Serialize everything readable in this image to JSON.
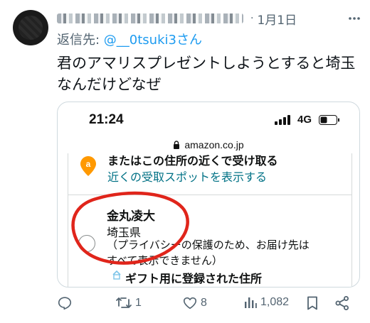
{
  "tweet": {
    "date": "1月1日",
    "reply_to_prefix": "返信先: ",
    "reply_to_mention": "@__0tsuki3さん",
    "text_line1": "君のアマリスプレゼントしようとすると埼玉",
    "text_line2": "なんだけどなぜ"
  },
  "screenshot": {
    "time": "21:24",
    "network": "4G",
    "url": "amazon.co.jp",
    "pickup_title": "またはこの住所の近くで受け取る",
    "pickup_link": "近くの受取スポットを表示する",
    "address_name": "金丸凌大",
    "address_prefecture": "埼玉県",
    "address_note_line1": "（プライバシーの保護のため、お届け先は",
    "address_note_line2": "すべて表示できません）",
    "gift_label": "ギフト用に登録された住所"
  },
  "actions": {
    "retweets": "1",
    "likes": "8",
    "views": "1,082"
  },
  "colors": {
    "link": "#1d9bf0",
    "muted": "#536471",
    "amazon_orange": "#ff9900",
    "amazon_link": "#007185",
    "annotation_red": "#e0251b"
  }
}
